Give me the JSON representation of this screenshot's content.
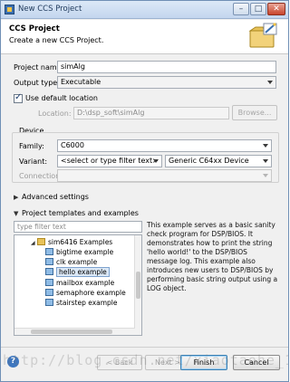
{
  "window": {
    "title": "New CCS Project"
  },
  "header": {
    "title": "CCS Project",
    "subtitle": "Create a new CCS Project."
  },
  "form": {
    "project_name_label": "Project name:",
    "project_name_value": "simAlg",
    "output_type_label": "Output type:",
    "output_type_value": "Executable",
    "use_default_location_label": "Use default location",
    "use_default_location_checked": true,
    "location_label": "Location:",
    "location_value": "D:\\dsp_soft\\simAlg",
    "browse_label": "Browse..."
  },
  "device": {
    "group_label": "Device",
    "family_label": "Family:",
    "family_value": "C6000",
    "variant_label": "Variant:",
    "variant_filter": "<select or type filter text>",
    "variant_value": "Generic C64xx Device",
    "connection_label": "Connection:",
    "connection_value": ""
  },
  "advanced_settings_label": "Advanced settings",
  "templates": {
    "section_label": "Project templates and examples",
    "filter_placeholder": "type filter text",
    "tree": [
      {
        "label": "sim6416 Examples",
        "type": "folder",
        "expanded": true
      },
      {
        "label": "bigtime example",
        "type": "project"
      },
      {
        "label": "clk example",
        "type": "project"
      },
      {
        "label": "hello example",
        "type": "project",
        "selected": true
      },
      {
        "label": "mailbox example",
        "type": "project"
      },
      {
        "label": "semaphore example",
        "type": "project"
      },
      {
        "label": "stairstep example",
        "type": "project"
      }
    ],
    "description": "This example serves as a basic sanity check program for DSP/BIOS. It demonstrates how to print the string 'hello world!' to the DSP/BIOS message log. This example also introduces new users to DSP/BIOS by performing basic string output using a LOG object."
  },
  "buttons": {
    "back": "< Back",
    "next": "Next >",
    "finish": "Finish",
    "cancel": "Cancel"
  },
  "icons": {
    "help": "help-icon",
    "app": "ccs-app-icon",
    "wizard": "folder-wizard-icon"
  },
  "watermark": "http://blog.csdn.net/xiaotaohe_1"
}
